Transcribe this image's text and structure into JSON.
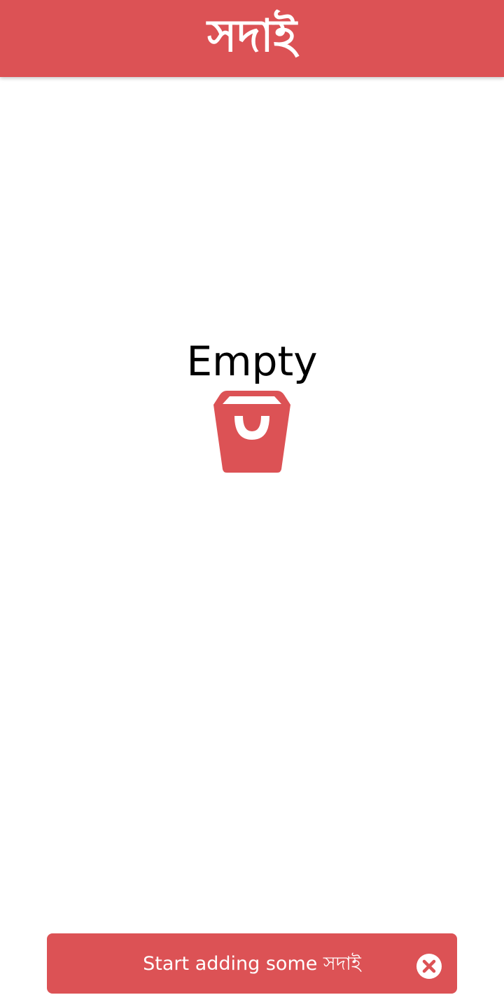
{
  "appbar": {
    "title": "সদাই"
  },
  "empty_state": {
    "label": "Empty",
    "icon": "shopping-bucket-icon"
  },
  "snackbar": {
    "message": "Start adding some সদাই",
    "close_icon": "close-circle-icon"
  },
  "colors": {
    "brand": "#dc5255",
    "background": "#ffffff",
    "text": "#000000",
    "on_brand": "#ffffff"
  }
}
